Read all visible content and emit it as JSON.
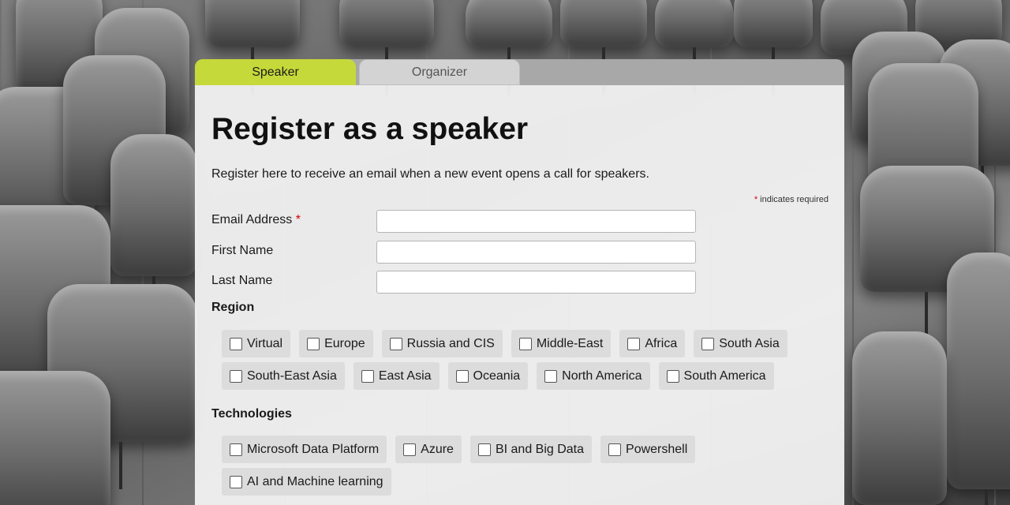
{
  "tabs": [
    {
      "label": "Speaker",
      "active": true
    },
    {
      "label": "Organizer",
      "active": false
    }
  ],
  "form": {
    "title": "Register as a speaker",
    "intro": "Register here to receive an email when a new event opens a call for speakers.",
    "required_note": "indicates required",
    "required_marker": "*",
    "fields": {
      "email_label": "Email Address",
      "first_name_label": "First Name",
      "last_name_label": "Last Name"
    },
    "region": {
      "label": "Region",
      "options": [
        "Virtual",
        "Europe",
        "Russia and CIS",
        "Middle-East",
        "Africa",
        "South Asia",
        "South-East Asia",
        "East Asia",
        "Oceania",
        "North America",
        "South America"
      ]
    },
    "technologies": {
      "label": "Technologies",
      "options": [
        "Microsoft Data Platform",
        "Azure",
        "BI and Big Data",
        "Powershell",
        "AI and Machine learning"
      ]
    }
  },
  "colors": {
    "active_tab": "#c6d93a",
    "required": "#d10000"
  }
}
